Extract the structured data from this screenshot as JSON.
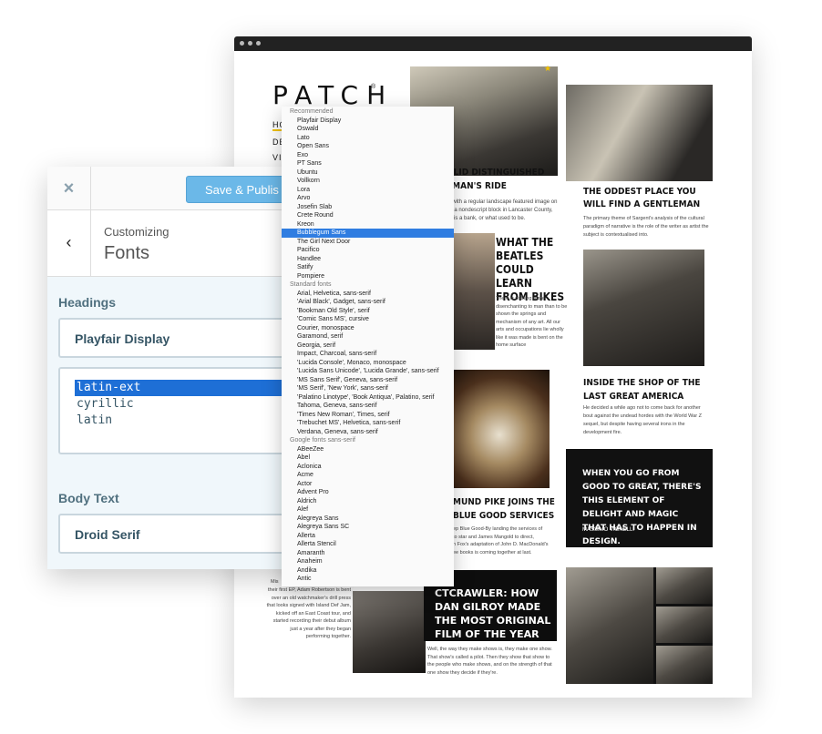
{
  "site": {
    "logo": "PATCH",
    "logo_reg": "®",
    "nav": [
      "HO",
      "DE",
      "VI"
    ],
    "articles": [
      {
        "headline": "SOLID DISTINGUISHED GENTLEMAN'S RIDE",
        "headline_visible": "OLID DISTINGUISHED\nEMAN'S RIDE",
        "excerpt": "st with a regular landscape featured image on\n of a nondescript block in Lancaster County,\nia, is a bank, or what used to be."
      },
      {
        "headline": "THE ODDEST PLACE YOU WILL FIND A GENTLEMAN",
        "excerpt": "The primary theme of Sargent's analysis of the cultural\nparadigm of narrative is the role of the writer as artist the\nsubject is contextualised into."
      },
      {
        "headline": "WHAT THE BEATLES COULD LEARN FROM BIKES",
        "excerpt": "There is nothing more\ndisenchanting to man than to be\nshown the springs and\nmechanism of any art. All our\narts and occupations lie wholly\nlike it was made is bent on the\nhome surface"
      },
      {
        "headline": "INSIDE THE SHOP OF THE LAST GREAT AMERICA",
        "excerpt": "He decided a while ago not to come back for another\nbout against the undead hordes with the World War Z\nsequel, but despite having several irons in the\ndevelopment fire."
      },
      {
        "headline": "MUND PIKE JOINS THE BLUE GOOD SERVICES",
        "excerpt": "ep Blue Good-By landing the services of\nto star and James Mangold to direct,\nh Fox's adaptation of John D. MacDonald's\nee books is coming together at last."
      },
      {
        "headline": "CTCRAWLER: HOW DAN GILROY MADE THE MOST ORIGINAL FILM OF THE YEAR",
        "excerpt": "Well, the way they make shows is, they make one show.\nThat show's called a pilot. Then they show that show to\nthe people who make shows, and on the strength of that\none show they decide if they're."
      }
    ],
    "quote": {
      "text": "WHEN YOU GO FROM GOOD TO GREAT, THERE'S THIS ELEMENT OF DELIGHT AND MAGIC THAT HAS TO HAPPEN IN DESIGN.",
      "author": "MASSIMO VIGNELLI"
    },
    "left_column_excerpt": "their first EP, Adam Robertson is bent\nover an old watchmaker's drill press\nthat looks signed with Island Def Jam,\nkicked off an East Coast tour, and\nstarted recording their debut album\njust a year after they began\nperforming together.",
    "left_fragments": [
      "things",
      "Mis"
    ]
  },
  "customizer": {
    "close_icon": "×",
    "publish_label": "Save & Publish",
    "publish_visible": "Save & Publis",
    "back_icon": "‹",
    "customizing_label": "Customizing",
    "section_title": "Fonts",
    "headings_label": "Headings",
    "headings_font": "Playfair Display",
    "subsets": [
      "latin-ext",
      "cyrillic",
      "latin"
    ],
    "subset_selected": "latin-ext",
    "body_label": "Body Text",
    "body_font": "Droid Serif"
  },
  "font_dropdown": {
    "selected": "Bubblegum Sans",
    "items": [
      {
        "label": "Recommended",
        "group": true
      },
      {
        "label": "Playfair Display"
      },
      {
        "label": "Oswald"
      },
      {
        "label": "Lato"
      },
      {
        "label": "Open Sans"
      },
      {
        "label": "Exo"
      },
      {
        "label": "PT Sans"
      },
      {
        "label": "Ubuntu"
      },
      {
        "label": "Vollkorn"
      },
      {
        "label": "Lora"
      },
      {
        "label": "Arvo"
      },
      {
        "label": "Josefin Slab"
      },
      {
        "label": "Crete Round"
      },
      {
        "label": "Kreon"
      },
      {
        "label": "Bubblegum Sans"
      },
      {
        "label": "The Girl Next Door"
      },
      {
        "label": "Pacifico"
      },
      {
        "label": "Handlee"
      },
      {
        "label": "Satify"
      },
      {
        "label": "Pompiere"
      },
      {
        "label": "Standard fonts",
        "group": true
      },
      {
        "label": "Arial, Helvetica, sans-serif"
      },
      {
        "label": "'Arial Black', Gadget, sans-serif"
      },
      {
        "label": "'Bookman Old Style', serif"
      },
      {
        "label": "'Comic Sans MS', cursive"
      },
      {
        "label": "Courier, monospace"
      },
      {
        "label": "Garamond, serif"
      },
      {
        "label": "Georgia, serif"
      },
      {
        "label": "Impact, Charcoal, sans-serif"
      },
      {
        "label": "'Lucida Console', Monaco, monospace"
      },
      {
        "label": "'Lucida Sans Unicode', 'Lucida Grande', sans-serif"
      },
      {
        "label": "'MS Sans Serif', Geneva, sans-serif"
      },
      {
        "label": "'MS Serif', 'New York', sans-serif"
      },
      {
        "label": "'Palatino Linotype', 'Book Antiqua', Palatino, serif"
      },
      {
        "label": "Tahoma, Geneva, sans-serif"
      },
      {
        "label": "'Times New Roman', Times, serif"
      },
      {
        "label": "'Trebuchet MS', Helvetica, sans-serif"
      },
      {
        "label": "Verdana, Geneva, sans-serif"
      },
      {
        "label": "Google fonts sans-serif",
        "group": true
      },
      {
        "label": "ABeeZee"
      },
      {
        "label": "Abel"
      },
      {
        "label": "Aclonica"
      },
      {
        "label": "Acme"
      },
      {
        "label": "Actor"
      },
      {
        "label": "Advent Pro"
      },
      {
        "label": "Aldrich"
      },
      {
        "label": "Alef"
      },
      {
        "label": "Alegreya Sans"
      },
      {
        "label": "Alegreya Sans SC"
      },
      {
        "label": "Allerta"
      },
      {
        "label": "Allerta Stencil"
      },
      {
        "label": "Amaranth"
      },
      {
        "label": "Anaheim"
      },
      {
        "label": "Andika"
      },
      {
        "label": "Antic"
      }
    ]
  },
  "colors": {
    "accent_blue": "#2f7de1",
    "publish_blue": "#6bb8e8",
    "panel_bg": "#f0f7fb",
    "logo_accent": "#f2c200"
  }
}
